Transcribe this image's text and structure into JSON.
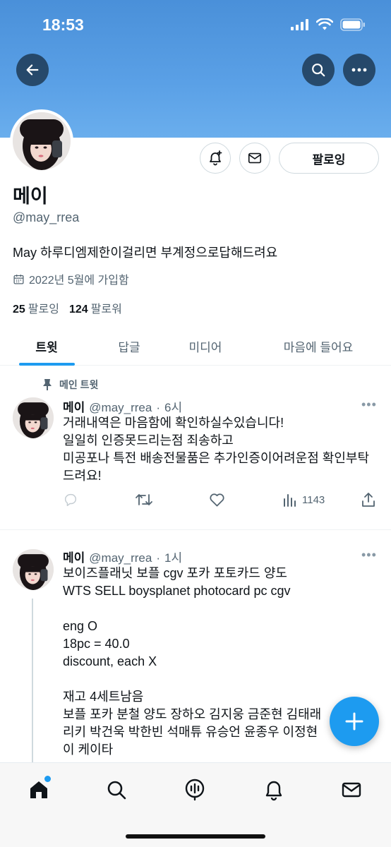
{
  "status_bar": {
    "time": "18:53"
  },
  "profile": {
    "display_name": "메이",
    "handle": "@may_rrea",
    "bio": "May 하루디엠제한이걸리면 부계정으로답해드려요",
    "joined": "2022년 5월에 가입함",
    "following_count": "25",
    "following_label": "팔로잉",
    "followers_count": "124",
    "followers_label": "팔로워",
    "follow_button_label": "팔로잉"
  },
  "tabs": [
    {
      "label": "트윗",
      "active": true
    },
    {
      "label": "답글",
      "active": false
    },
    {
      "label": "미디어",
      "active": false
    },
    {
      "label": "마음에 들어요",
      "active": false
    }
  ],
  "pinned_label": "메인 트윗",
  "tweets": [
    {
      "name": "메이",
      "handle": "@may_rrea",
      "time": "6시",
      "lines": [
        "거래내역은 마음함에 확인하실수있습니다!",
        "일일히 인증못드리는점 죄송하고",
        "미공포나 특전 배송전물품은 추가인증이어려운점 확인부탁",
        "드려요!"
      ],
      "views": "1143"
    },
    {
      "name": "메이",
      "handle": "@may_rrea",
      "time": "1시",
      "lines": [
        "보이즈플래닛 보플 cgv 포카 포토카드 양도",
        "WTS SELL boysplanet photocard pc cgv",
        "",
        "eng O",
        "18pc = 40.0",
        "discount, each X",
        "",
        "재고 4세트남음",
        "보플 포카 분철 양도 장하오 김지웅 금준현 김태래",
        "리키 박건욱 박한빈 석매튜 유승언 윤종우 이정현",
        "이 케이타"
      ]
    }
  ],
  "icons": {
    "back": "back-arrow-icon",
    "search": "search-icon",
    "more": "more-icon",
    "notify": "bell-plus-icon",
    "message": "envelope-icon",
    "calendar": "calendar-icon",
    "pin": "pin-icon",
    "reply": "reply-icon",
    "retweet": "retweet-icon",
    "like": "heart-icon",
    "views": "views-icon",
    "share": "share-icon",
    "compose": "compose-plus-icon",
    "nav_home": "home-icon",
    "nav_search": "search-icon",
    "nav_spaces": "spaces-icon",
    "nav_notifications": "bell-icon",
    "nav_messages": "envelope-icon"
  },
  "colors": {
    "accent": "#1d9bf0",
    "banner": "#4a90d9",
    "text": "#0f1419",
    "muted": "#536471"
  }
}
